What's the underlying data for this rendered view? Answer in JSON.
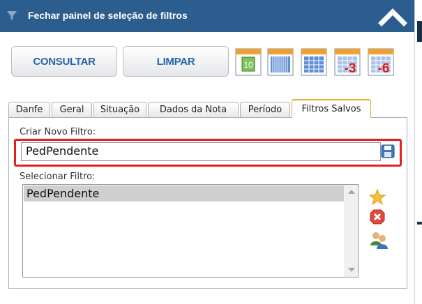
{
  "header": {
    "title": "Fechar painel de seleção de filtros",
    "funnel_icon": "funnel-icon",
    "collapse_icon": "chevron-up-icon",
    "background": "#2c5d8f"
  },
  "toolbar": {
    "consultar_label": "CONSULTAR",
    "limpar_label": "LIMPAR",
    "calendars": [
      {
        "icon": "calendar-10-icon",
        "label": "10"
      },
      {
        "icon": "calendar-month-icon",
        "label": ""
      },
      {
        "icon": "calendar-week-icon",
        "label": ""
      },
      {
        "icon": "calendar-minus-3-icon",
        "label": "-3"
      },
      {
        "icon": "calendar-minus-6-icon",
        "label": "-6"
      }
    ]
  },
  "tabs": [
    {
      "label": "Danfe",
      "active": false
    },
    {
      "label": "Geral",
      "active": false
    },
    {
      "label": "Situação",
      "active": false
    },
    {
      "label": "Dados da Nota",
      "active": false
    },
    {
      "label": "Período",
      "active": false
    },
    {
      "label": "Filtros Salvos",
      "active": true
    }
  ],
  "filtros": {
    "criar_label": "Criar Novo Filtro:",
    "novo_filtro_value": "PedPendente",
    "save_icon": "save-icon",
    "selecionar_label": "Selecionar Filtro:",
    "items": [
      "PedPendente"
    ],
    "side_icons": [
      "star-icon",
      "delete-icon",
      "share-users-icon"
    ]
  },
  "colors": {
    "accent_blue": "#2a64a8",
    "highlight_red": "#e0211f",
    "active_tab_orange": "#f0a72f"
  }
}
